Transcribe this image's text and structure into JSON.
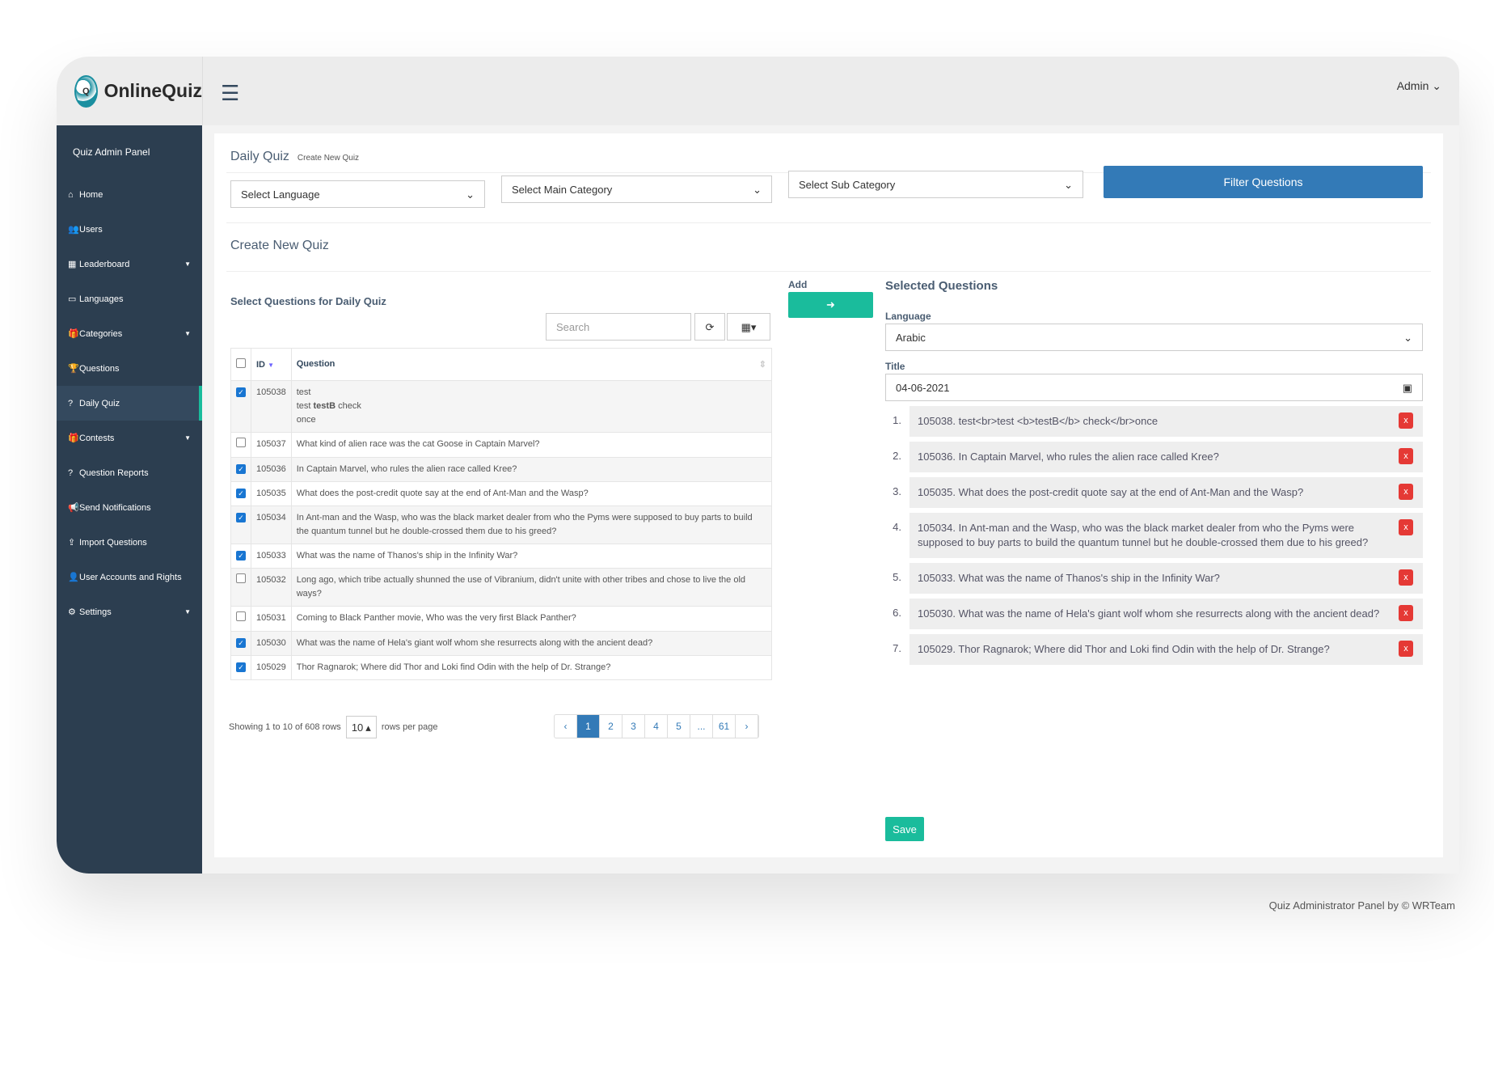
{
  "brand": {
    "name": "OnlineQuiz",
    "logo_text": "Quiz"
  },
  "header": {
    "admin_label": "Admin"
  },
  "sidebar": {
    "panel_title": "Quiz Admin Panel",
    "items": [
      {
        "label": "Home",
        "icon": "⌂",
        "caret": false
      },
      {
        "label": "Users",
        "icon": "👥",
        "caret": false
      },
      {
        "label": "Leaderboard",
        "icon": "▦",
        "caret": true
      },
      {
        "label": "Languages",
        "icon": "▭",
        "caret": false
      },
      {
        "label": "Categories",
        "icon": "🎁",
        "caret": true
      },
      {
        "label": "Questions",
        "icon": "🏆",
        "caret": false
      },
      {
        "label": "Daily Quiz",
        "icon": "?",
        "caret": false,
        "active": true
      },
      {
        "label": "Contests",
        "icon": "🎁",
        "caret": true
      },
      {
        "label": "Question Reports",
        "icon": "?",
        "caret": false
      },
      {
        "label": "Send Notifications",
        "icon": "📢",
        "caret": false
      },
      {
        "label": "Import Questions",
        "icon": "⇪",
        "caret": false
      },
      {
        "label": "User Accounts and Rights",
        "icon": "👤",
        "caret": false
      },
      {
        "label": "Settings",
        "icon": "⚙",
        "caret": true
      }
    ]
  },
  "page": {
    "title": "Daily Quiz",
    "breadcrumb": "Create New Quiz",
    "section_title": "Create New Quiz"
  },
  "filters": {
    "language": "Select Language",
    "main_category": "Select Main Category",
    "sub_category": "Select Sub Category",
    "filter_button": "Filter Questions"
  },
  "left": {
    "title": "Select Questions for Daily Quiz",
    "search_placeholder": "Search",
    "col_id": "ID",
    "col_question": "Question",
    "rows": [
      {
        "id": "105038",
        "checked": true,
        "q": "test<br>test <b>testB</b> check<br>once"
      },
      {
        "id": "105037",
        "checked": false,
        "q": "What kind of alien race was the cat Goose in Captain Marvel?"
      },
      {
        "id": "105036",
        "checked": true,
        "q": "In Captain Marvel, who rules the alien race called Kree?"
      },
      {
        "id": "105035",
        "checked": true,
        "q": "What does the post-credit quote say at the end of Ant-Man and the Wasp?"
      },
      {
        "id": "105034",
        "checked": true,
        "q": "In Ant-man and the Wasp, who was the black market dealer from who the Pyms were supposed to buy parts to build the quantum tunnel but he double-crossed them due to his greed?"
      },
      {
        "id": "105033",
        "checked": true,
        "q": "What was the name of Thanos's ship in the Infinity War?"
      },
      {
        "id": "105032",
        "checked": false,
        "q": "Long ago, which tribe actually shunned the use of Vibranium, didn't unite with other tribes and chose to live the old ways?"
      },
      {
        "id": "105031",
        "checked": false,
        "q": "Coming to Black Panther movie, Who was the very first Black Panther?"
      },
      {
        "id": "105030",
        "checked": true,
        "q": "What was the name of Hela's giant wolf whom she resurrects along with the ancient dead?"
      },
      {
        "id": "105029",
        "checked": true,
        "q": "Thor Ragnarok; Where did Thor and Loki find Odin with the help of Dr. Strange?"
      }
    ],
    "showing": "Showing 1 to 10 of 608 rows",
    "page_size": "10",
    "rows_per_page": "rows per page",
    "pages": [
      "‹",
      "1",
      "2",
      "3",
      "4",
      "5",
      "...",
      "61",
      "›"
    ],
    "current_page": "1"
  },
  "add": {
    "label": "Add"
  },
  "right": {
    "title": "Selected Questions",
    "language_label": "Language",
    "language_value": "Arabic",
    "title_label": "Title",
    "title_value": "04-06-2021",
    "selected": [
      "105038. test<br>test <b>testB</b> check</br>once",
      "105036. In Captain Marvel, who rules the alien race called Kree?",
      "105035. What does the post-credit quote say at the end of Ant-Man and the Wasp?",
      "105034. In Ant-man and the Wasp, who was the black market dealer from who the Pyms were supposed to buy parts to build the quantum tunnel but he double-crossed them due to his greed?",
      "105033. What was the name of Thanos's ship in the Infinity War?",
      "105030. What was the name of Hela's giant wolf whom she resurrects along with the ancient dead?",
      "105029. Thor Ragnarok; Where did Thor and Loki find Odin with the help of Dr. Strange?"
    ],
    "remove_label": "x",
    "save_label": "Save"
  },
  "footer": {
    "text": "Quiz Administrator Panel by © WRTeam"
  },
  "colors": {
    "sidebar": "#2c3e50",
    "primary": "#337ab7",
    "success": "#1abc9c",
    "danger": "#e53935"
  }
}
